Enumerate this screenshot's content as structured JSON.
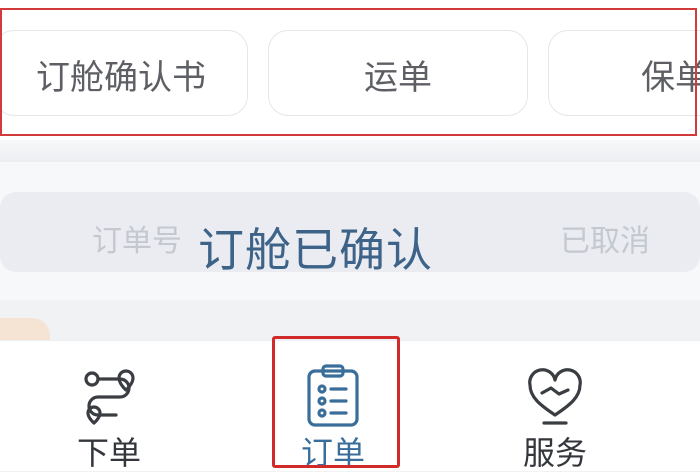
{
  "doc_tabs": {
    "items": [
      {
        "label": "订舱确认书"
      },
      {
        "label": "运单"
      },
      {
        "label": "保单"
      }
    ]
  },
  "order_filter": {
    "faded_tabs": [
      "订单号",
      "已取消"
    ],
    "status_overlay": "订舱已确认"
  },
  "bottom_nav": {
    "items": [
      {
        "label": "下单",
        "icon": "route-icon"
      },
      {
        "label": "订单",
        "icon": "clipboard-list-icon"
      },
      {
        "label": "服务",
        "icon": "heart-hand-icon"
      }
    ],
    "active_index": 1
  },
  "colors": {
    "highlight_red": "#d23b3b",
    "active_blue": "#3a6e9a",
    "status_blue": "#3d6388",
    "chip_border": "#e4e6ea"
  }
}
